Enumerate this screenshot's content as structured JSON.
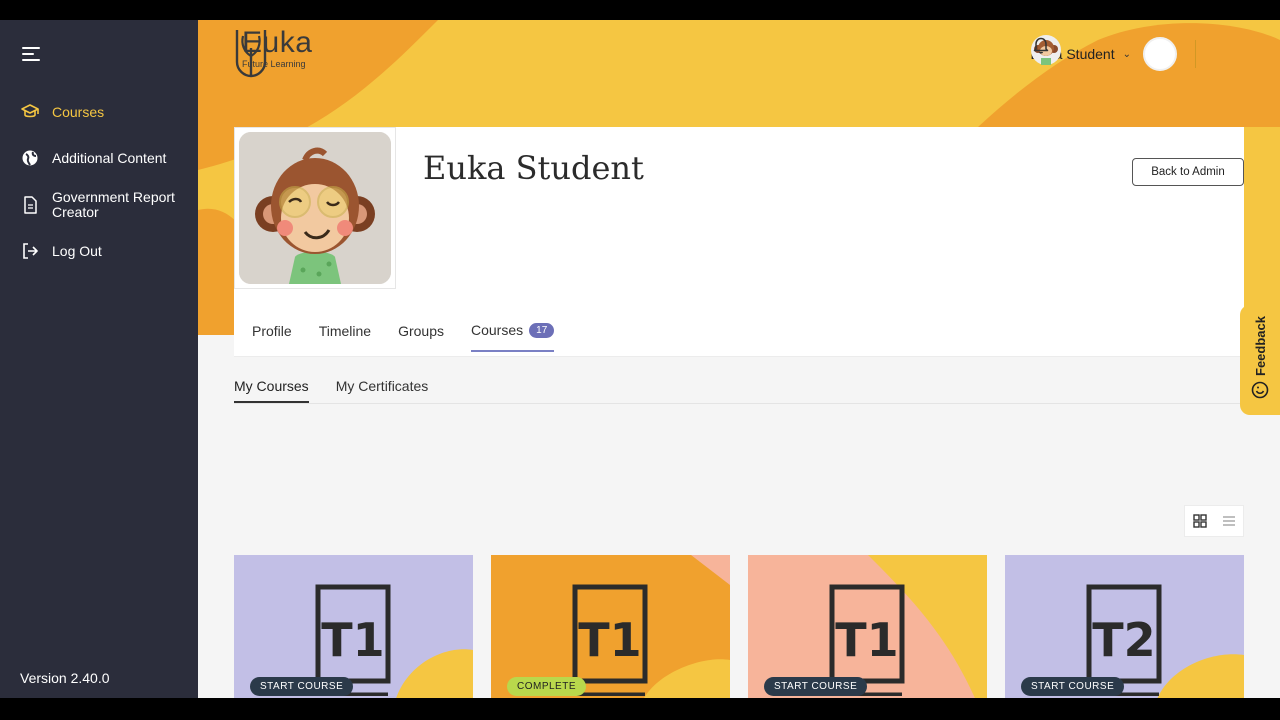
{
  "sidebar": {
    "items": [
      {
        "label": "Courses",
        "icon": "graduation-cap-icon"
      },
      {
        "label": "Additional Content",
        "icon": "globe-icon"
      },
      {
        "label": "Government Report Creator",
        "icon": "document-icon"
      },
      {
        "label": "Log Out",
        "icon": "logout-icon"
      }
    ],
    "version": "Version 2.40.0"
  },
  "header": {
    "logo": {
      "brand": "Euka",
      "tagline": "Future Learning"
    },
    "user_name": "Euka Student"
  },
  "profile": {
    "name": "Euka Student",
    "back_button": "Back to Admin",
    "tabs": [
      {
        "label": "Profile"
      },
      {
        "label": "Timeline"
      },
      {
        "label": "Groups"
      },
      {
        "label": "Courses",
        "badge": "17"
      }
    ],
    "subtabs": [
      {
        "label": "My Courses"
      },
      {
        "label": "My Certificates"
      }
    ]
  },
  "courses": [
    {
      "book_label": "T1",
      "status": "START COURSE"
    },
    {
      "book_label": "T1",
      "status": "COMPLETE"
    },
    {
      "book_label": "T1",
      "status": "START COURSE"
    },
    {
      "book_label": "T2",
      "status": "START COURSE"
    }
  ],
  "feedback": {
    "label": "Feedback"
  },
  "colors": {
    "sidebar_bg": "#2b2d3b",
    "accent_yellow": "#f5c642",
    "accent_orange": "#f0a12e",
    "lavender": "#c2bfe6",
    "peach": "#f7b49a",
    "badge_purple": "#6c6fb7"
  }
}
